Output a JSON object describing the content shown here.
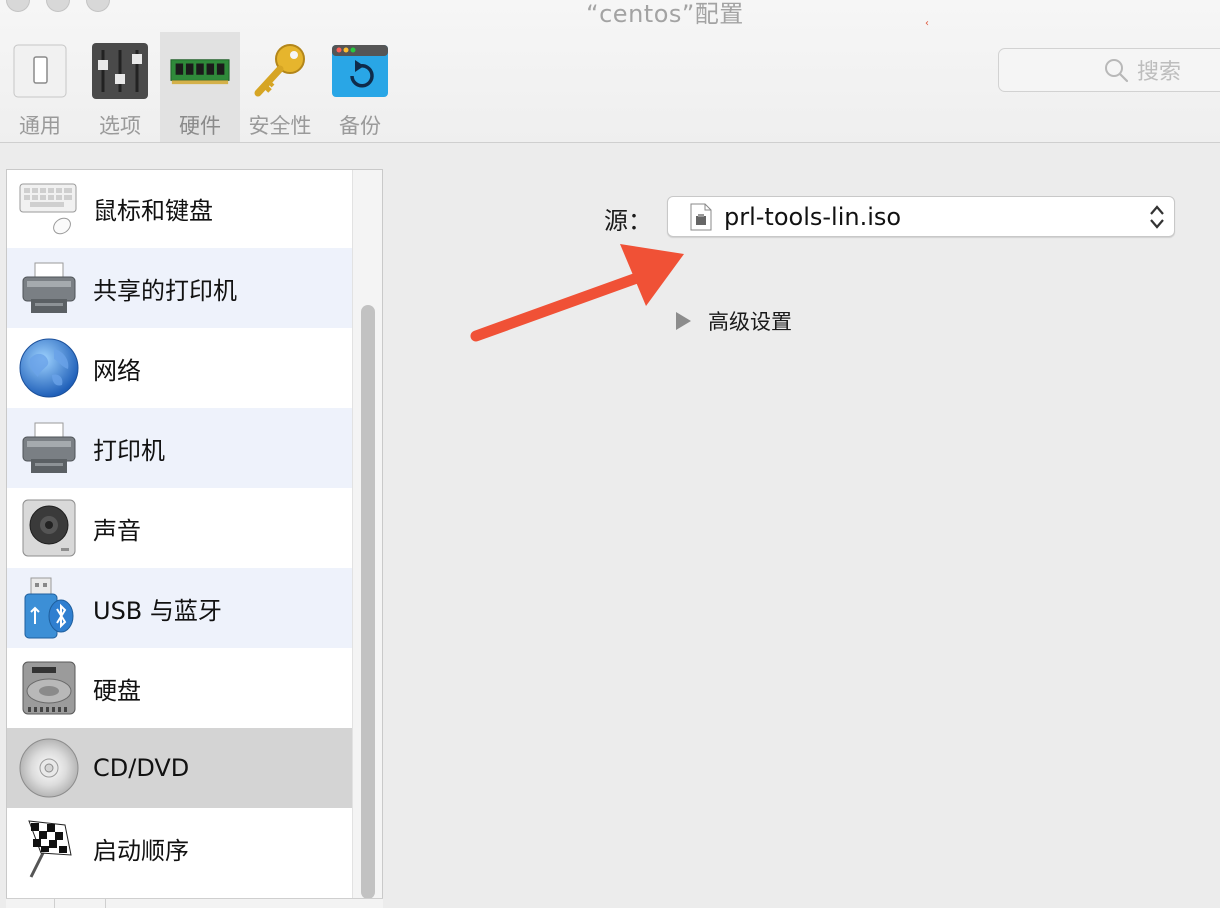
{
  "window": {
    "title": "“centos”配置"
  },
  "toolbar": {
    "tabs": [
      {
        "label": "通用",
        "icon": "general-icon"
      },
      {
        "label": "选项",
        "icon": "options-sliders-icon"
      },
      {
        "label": "硬件",
        "icon": "hardware-memory-icon",
        "active": true
      },
      {
        "label": "安全性",
        "icon": "security-key-icon"
      },
      {
        "label": "备份",
        "icon": "backup-icon"
      }
    ],
    "search_placeholder": "搜索"
  },
  "sidebar": {
    "items": [
      {
        "label": "鼠标和键盘",
        "icon": "keyboard-mouse-icon"
      },
      {
        "label": "共享的打印机",
        "icon": "printer-icon"
      },
      {
        "label": "网络",
        "icon": "globe-icon"
      },
      {
        "label": "打印机",
        "icon": "printer-icon"
      },
      {
        "label": "声音",
        "icon": "speaker-icon"
      },
      {
        "label": "USB 与蓝牙",
        "icon": "usb-bluetooth-icon"
      },
      {
        "label": "硬盘",
        "icon": "hard-disk-icon"
      },
      {
        "label": "CD/DVD",
        "icon": "cd-dvd-icon",
        "selected": true
      },
      {
        "label": "启动顺序",
        "icon": "checkered-flag-icon"
      }
    ]
  },
  "main": {
    "source_label": "源：",
    "source_value": "prl-tools-lin.iso",
    "advanced_label": "高级设置"
  },
  "colors": {
    "annotation_arrow": "#f05136",
    "selected_row": "#d4d4d4",
    "alternate_row": "#eef2fb"
  }
}
